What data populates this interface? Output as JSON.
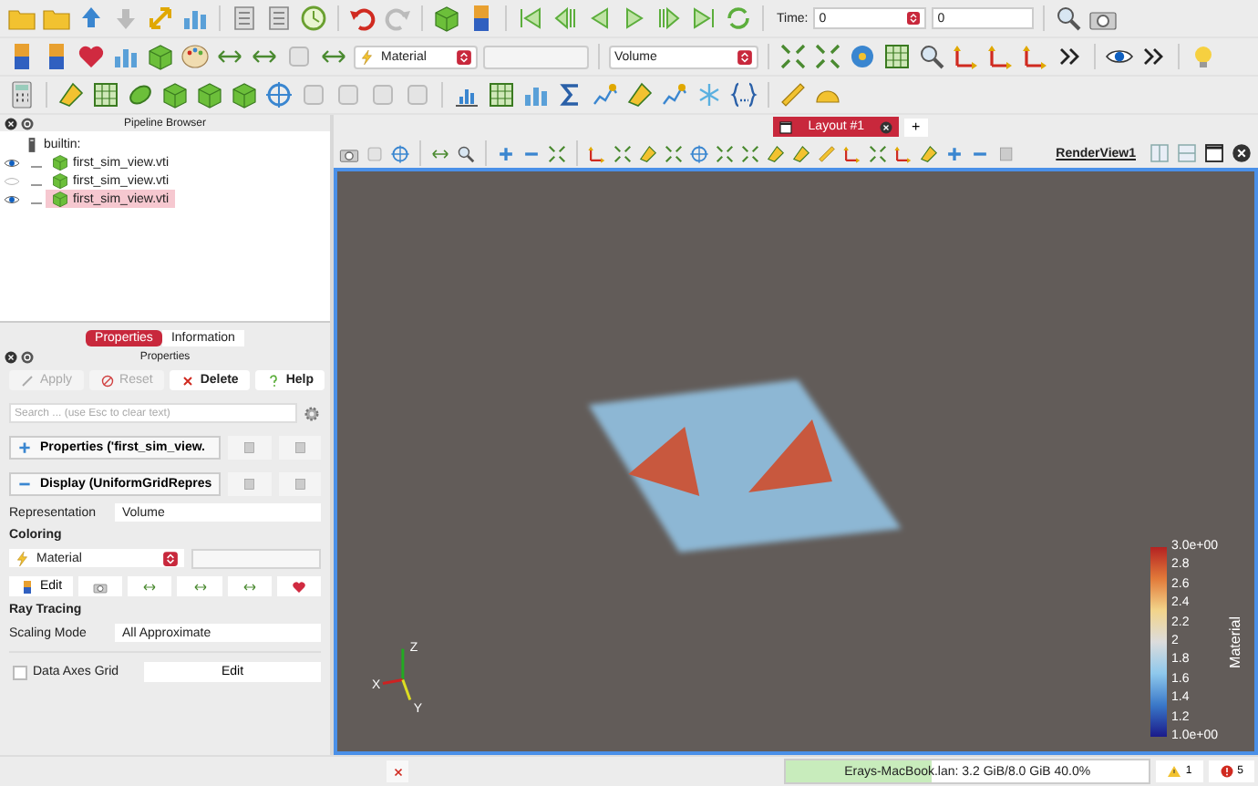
{
  "toolbar": {
    "time_label": "Time:",
    "time_value": "0",
    "time_index": "0",
    "color_array": "Material",
    "representation": "Volume"
  },
  "pipeline_browser": {
    "title": "Pipeline Browser",
    "root": "builtin:",
    "items": [
      {
        "label": "first_sim_view.vti",
        "visible": true,
        "selected": false
      },
      {
        "label": "first_sim_view.vti",
        "visible": false,
        "selected": false
      },
      {
        "label": "first_sim_view.vti",
        "visible": true,
        "selected": true
      }
    ]
  },
  "panel_tabs": [
    {
      "label": "Properties",
      "selected": true
    },
    {
      "label": "Information",
      "selected": false
    }
  ],
  "properties": {
    "title": "Properties",
    "buttons": [
      {
        "kind": "apply",
        "label": "Apply",
        "disabled": true
      },
      {
        "kind": "reset",
        "label": "Reset",
        "disabled": true
      },
      {
        "kind": "delete",
        "label": "Delete",
        "disabled": false
      },
      {
        "kind": "help",
        "label": "Help",
        "disabled": false
      }
    ],
    "search_placeholder": "Search ... (use Esc to clear text)",
    "sections": [
      {
        "label": "Properties ('first_sim_view.",
        "expanded": false
      },
      {
        "label": "Display (UniformGridRepres",
        "expanded": true
      }
    ],
    "representation_label": "Representation",
    "representation_value": "Volume",
    "coloring_heading": "Coloring",
    "coloring_array": "Material",
    "edit_label": "Edit",
    "ray_tracing_heading": "Ray Tracing",
    "scaling_mode_label": "Scaling Mode",
    "scaling_mode_value": "All Approximate",
    "data_axes_grid": {
      "label": "Data Axes Grid",
      "checked": false,
      "button": "Edit"
    }
  },
  "layout_tabs": [
    {
      "label": "Layout #1",
      "selected": true
    }
  ],
  "add_tab": "+",
  "view_title": "RenderView1",
  "axes": {
    "z": "Z",
    "x": "X",
    "y": "Y"
  },
  "color_legend": {
    "title": "Material",
    "labels": [
      "3.0e+00",
      "2.8",
      "2.6",
      "2.4",
      "2.2",
      "2",
      "1.8",
      "1.6",
      "1.4",
      "1.2",
      "1.0e+00"
    ]
  },
  "status_bar": {
    "memory": "Erays-MacBook.lan: 3.2 GiB/8.0 GiB 40.0%",
    "level": 0.4,
    "warnings": "1",
    "errors": "5"
  }
}
